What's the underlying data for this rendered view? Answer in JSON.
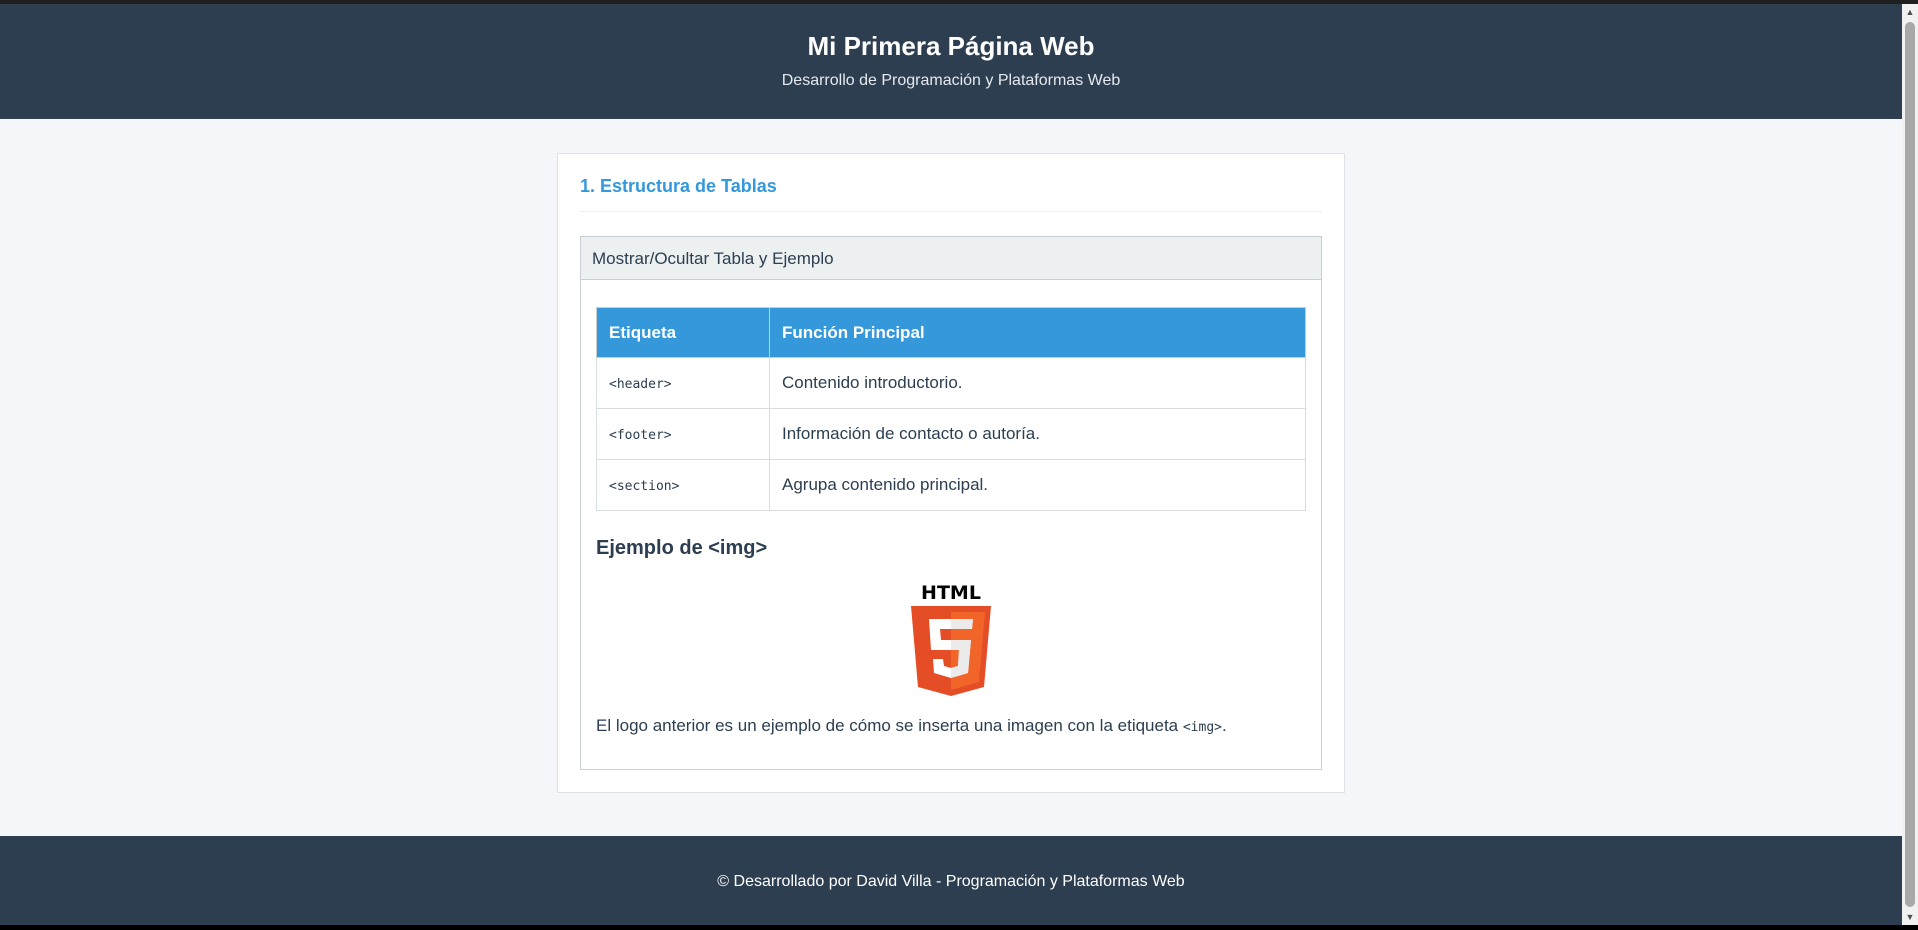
{
  "header": {
    "title": "Mi Primera Página Web",
    "subtitle": "Desarrollo de Programación y Plataformas Web"
  },
  "section": {
    "title": "1. Estructura de Tablas",
    "toggle_label": "Mostrar/Ocultar Tabla y Ejemplo",
    "table": {
      "headers": [
        "Etiqueta",
        "Función Principal"
      ],
      "rows": [
        {
          "tag": "<header>",
          "desc": "Contenido introductorio."
        },
        {
          "tag": "<footer>",
          "desc": "Información de contacto o autoría."
        },
        {
          "tag": "<section>",
          "desc": "Agrupa contenido principal."
        }
      ]
    },
    "example_title": "Ejemplo de <img>",
    "logo": {
      "text": "HTML",
      "digit": "5",
      "icon": "html5-logo-icon"
    },
    "caption_text": "El logo anterior es un ejemplo de cómo se inserta una imagen con la etiqueta ",
    "caption_code": "<img>",
    "caption_end": "."
  },
  "footer": {
    "text": "© Desarrollado por David Villa - Programación y Plataformas Web"
  },
  "colors": {
    "header_bg": "#2e3e51",
    "accent": "#3498db",
    "html5_orange": "#e44d26",
    "html5_light": "#f16529"
  }
}
